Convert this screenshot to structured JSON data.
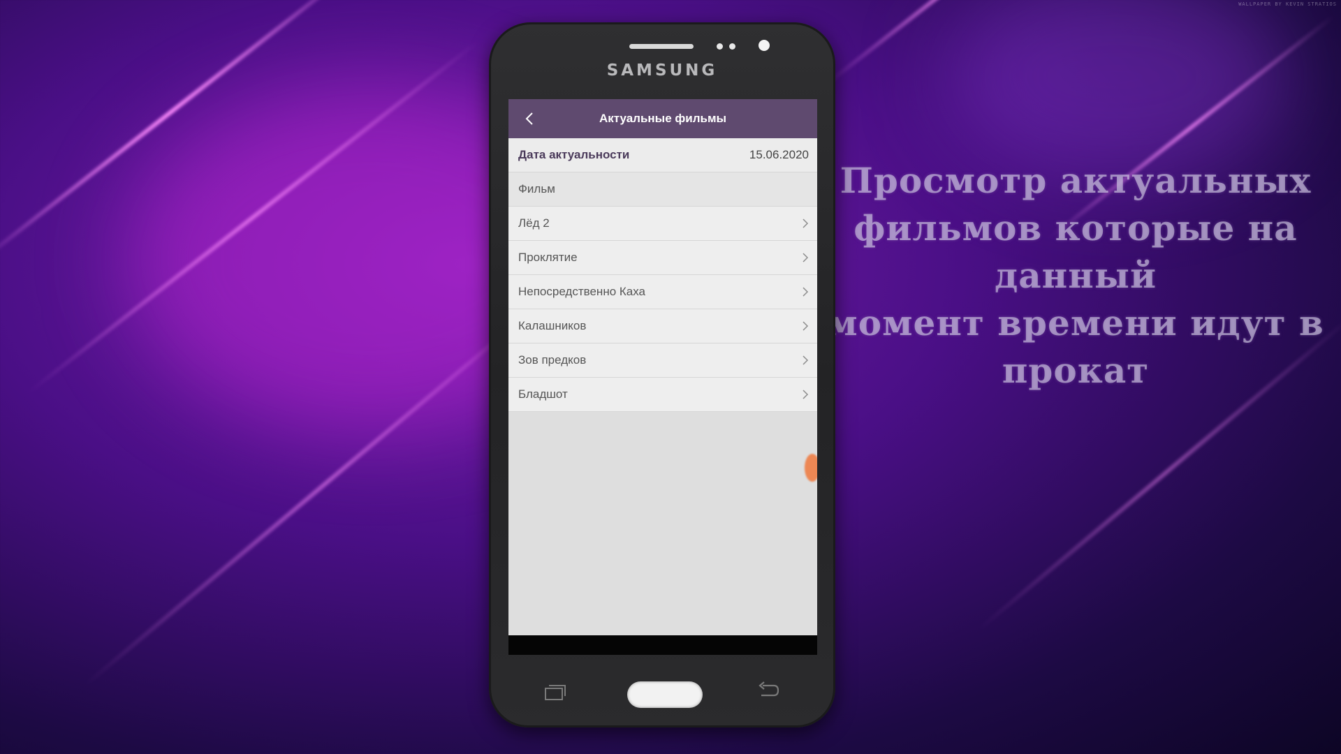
{
  "watermark": "WALLPAPER BY KEVIN STRATIOS",
  "overlay": {
    "line1": "Просмотр актуальных",
    "line2": "фильмов которые на данный",
    "line3": "момент времени идут в прокат"
  },
  "phone": {
    "brand": "SAMSUNG"
  },
  "app": {
    "title": "Актуальные фильмы",
    "back_icon": "chevron-left-icon",
    "date_label": "Дата актуальности",
    "date_value": "15.06.2020",
    "section_header": "Фильм",
    "films": [
      {
        "title": "Лёд 2"
      },
      {
        "title": "Проклятие"
      },
      {
        "title": "Непосредственно Каха"
      },
      {
        "title": "Калашников"
      },
      {
        "title": "Зов предков"
      },
      {
        "title": "Бладшот"
      }
    ]
  },
  "colors": {
    "appbar": "#5f4a6f",
    "background_accent": "#7b1fb0",
    "date_label": "#4a3a5a"
  }
}
